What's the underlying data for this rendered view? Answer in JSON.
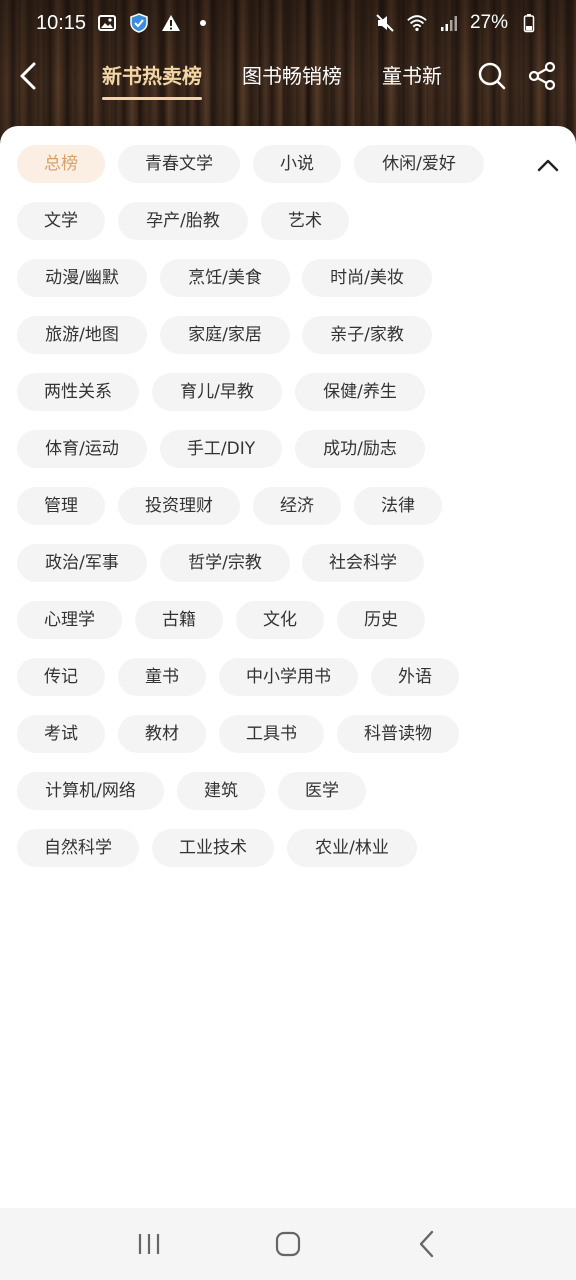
{
  "status_bar": {
    "time": "10:15",
    "battery": "27%"
  },
  "nav": {
    "tabs": [
      {
        "label": "新书热卖榜",
        "active": true
      },
      {
        "label": "图书畅销榜",
        "active": false
      },
      {
        "label": "童书新",
        "active": false
      }
    ],
    "accent_color": "#f2d6a6"
  },
  "categories": [
    "总榜",
    "青春文学",
    "小说",
    "休闲/爱好",
    "文学",
    "孕产/胎教",
    "艺术",
    "动漫/幽默",
    "烹饪/美食",
    "时尚/美妆",
    "旅游/地图",
    "家庭/家居",
    "亲子/家教",
    "两性关系",
    "育儿/早教",
    "保健/养生",
    "体育/运动",
    "手工/DIY",
    "成功/励志",
    "管理",
    "投资理财",
    "经济",
    "法律",
    "政治/军事",
    "哲学/宗教",
    "社会科学",
    "心理学",
    "古籍",
    "文化",
    "历史",
    "传记",
    "童书",
    "中小学用书",
    "外语",
    "考试",
    "教材",
    "工具书",
    "科普读物",
    "计算机/网络",
    "建筑",
    "医学",
    "自然科学",
    "工业技术",
    "农业/林业"
  ],
  "active_category": "总榜",
  "active_tag_color": "#d8a169",
  "icons": {
    "back": "chevron-left-icon",
    "search": "search-icon",
    "share": "share-icon",
    "collapse": "chevron-up-icon"
  }
}
